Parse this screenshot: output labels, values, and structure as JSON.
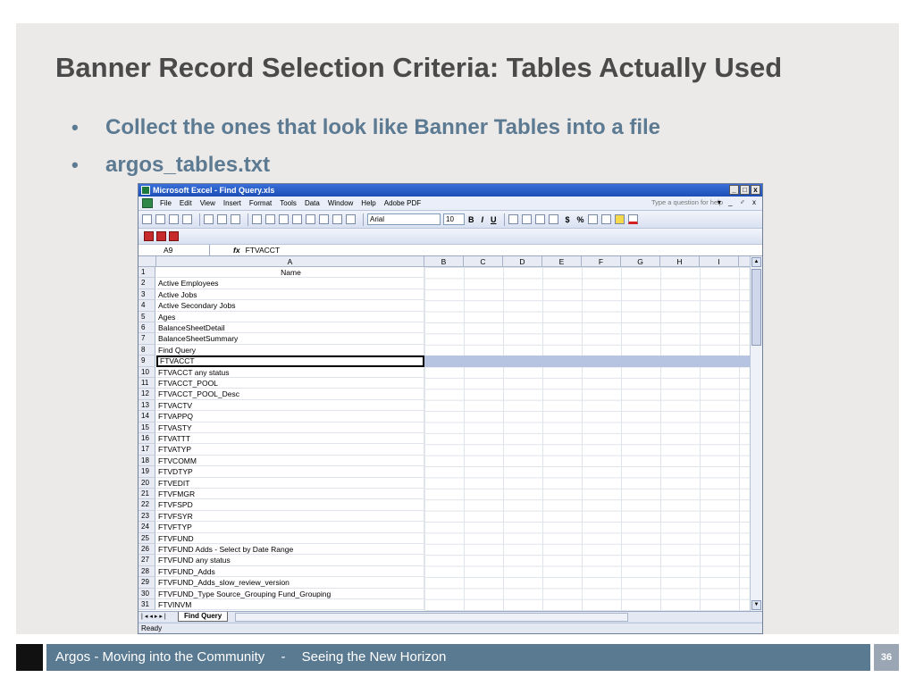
{
  "slide": {
    "title": "Banner Record Selection Criteria: Tables Actually Used",
    "bullets": [
      "Collect the ones that look like Banner Tables into a file",
      "argos_tables.txt"
    ],
    "bullet_char": "•",
    "footer": {
      "left": "Argos - Moving into the Community",
      "sep": "-",
      "right": "Seeing the New Horizon",
      "page": "36"
    },
    "colors": {
      "title": "#4a4a4a",
      "bullet": "#5c7a92",
      "footer_bar": "#5a7a92"
    }
  },
  "excel": {
    "window_title": "Microsoft Excel - Find Query.xls",
    "win_buttons": [
      "_",
      "□",
      "x"
    ],
    "menu": [
      "File",
      "Edit",
      "View",
      "Insert",
      "Format",
      "Tools",
      "Data",
      "Window",
      "Help",
      "Adobe PDF"
    ],
    "help_placeholder": "Type a question for help",
    "menu_controls": "▾ _ ♂ x",
    "font_name": "Arial",
    "font_size": "10",
    "format_buttons": [
      "B",
      "I",
      "U",
      "$",
      "%"
    ],
    "name_box": "A9",
    "fx": "fx",
    "formula_value": "FTVACCT",
    "columns": [
      "A",
      "B",
      "C",
      "D",
      "E",
      "F",
      "G",
      "H",
      "I"
    ],
    "rows": [
      {
        "n": "1",
        "v": "Name"
      },
      {
        "n": "2",
        "v": "Active Employees"
      },
      {
        "n": "3",
        "v": "Active Jobs"
      },
      {
        "n": "4",
        "v": "Active Secondary Jobs"
      },
      {
        "n": "5",
        "v": "Ages"
      },
      {
        "n": "6",
        "v": "BalanceSheetDetail"
      },
      {
        "n": "7",
        "v": "BalanceSheetSummary"
      },
      {
        "n": "8",
        "v": "Find Query"
      },
      {
        "n": "9",
        "v": "FTVACCT"
      },
      {
        "n": "10",
        "v": "FTVACCT any status"
      },
      {
        "n": "11",
        "v": "FTVACCT_POOL"
      },
      {
        "n": "12",
        "v": "FTVACCT_POOL_Desc"
      },
      {
        "n": "13",
        "v": "FTVACTV"
      },
      {
        "n": "14",
        "v": "FTVAPPQ"
      },
      {
        "n": "15",
        "v": "FTVASTY"
      },
      {
        "n": "16",
        "v": "FTVATTT"
      },
      {
        "n": "17",
        "v": "FTVATYP"
      },
      {
        "n": "18",
        "v": "FTVCOMM"
      },
      {
        "n": "19",
        "v": "FTVDTYP"
      },
      {
        "n": "20",
        "v": "FTVEDIT"
      },
      {
        "n": "21",
        "v": "FTVFMGR"
      },
      {
        "n": "22",
        "v": "FTVFSPD"
      },
      {
        "n": "23",
        "v": "FTVFSYR"
      },
      {
        "n": "24",
        "v": "FTVFTYP"
      },
      {
        "n": "25",
        "v": "FTVFUND"
      },
      {
        "n": "26",
        "v": "FTVFUND Adds - Select by Date Range"
      },
      {
        "n": "27",
        "v": "FTVFUND any status"
      },
      {
        "n": "28",
        "v": "FTVFUND_Adds"
      },
      {
        "n": "29",
        "v": "FTVFUND_Adds_slow_review_version"
      },
      {
        "n": "30",
        "v": "FTVFUND_Type Source_Grouping Fund_Grouping"
      },
      {
        "n": "31",
        "v": "FTVINVM"
      }
    ],
    "selected_row": "9",
    "sheet_tab": "Find Query",
    "status": "Ready"
  }
}
